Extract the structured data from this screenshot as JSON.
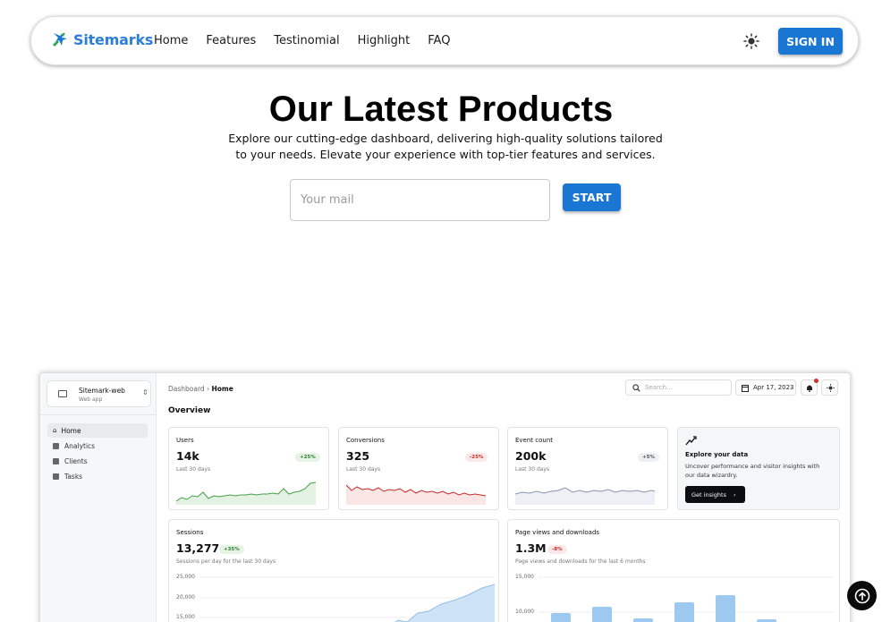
{
  "brand": {
    "name": "Sitemarks"
  },
  "nav": {
    "links": [
      "Home",
      "Features",
      "Testinomial",
      "Highlight",
      "FAQ"
    ],
    "theme_icon": "sun-icon",
    "signin_label": "SIGN IN"
  },
  "hero": {
    "title": "Our Latest Products",
    "subtitle": "Explore our cutting-edge dashboard, delivering high-quality solutions tailored to your needs. Elevate your experience with top-tier features and services.",
    "email_placeholder": "Your mail",
    "start_label": "START"
  },
  "dashboard": {
    "workspace": {
      "name": "Sitemark-web",
      "sub": "Web app"
    },
    "sidebar": [
      "Home",
      "Analytics",
      "Clients",
      "Tasks"
    ],
    "breadcrumb": {
      "parent": "Dashboard",
      "current": "Home"
    },
    "search_placeholder": "Search...",
    "date": "Apr 17, 2023",
    "section_title": "Overview",
    "stats": [
      {
        "title": "Users",
        "value": "14k",
        "change": "+25%",
        "trend": "up",
        "period": "Last 30 days"
      },
      {
        "title": "Conversions",
        "value": "325",
        "change": "-25%",
        "trend": "down",
        "period": "Last 30 days"
      },
      {
        "title": "Event count",
        "value": "200k",
        "change": "+5%",
        "trend": "neutral",
        "period": "Last 30 days"
      }
    ],
    "explore": {
      "title": "Explore your data",
      "desc": "Uncover performance and visitor insights with our data wizardry.",
      "button": "Get insights"
    },
    "sessions": {
      "title": "Sessions",
      "value": "13,277",
      "change": "+35%",
      "desc": "Sessions per day for the last 30 days",
      "yticks": [
        "25,000",
        "20,000",
        "15,000"
      ]
    },
    "pageviews": {
      "title": "Page views and downloads",
      "value": "1.3M",
      "change": "-8%",
      "desc": "Page views and downloads for the last 6 months",
      "yticks": [
        "15,000",
        "10,000"
      ]
    }
  },
  "colors": {
    "accent": "#1976d2",
    "green": "#2e7d32",
    "red": "#c62828"
  }
}
